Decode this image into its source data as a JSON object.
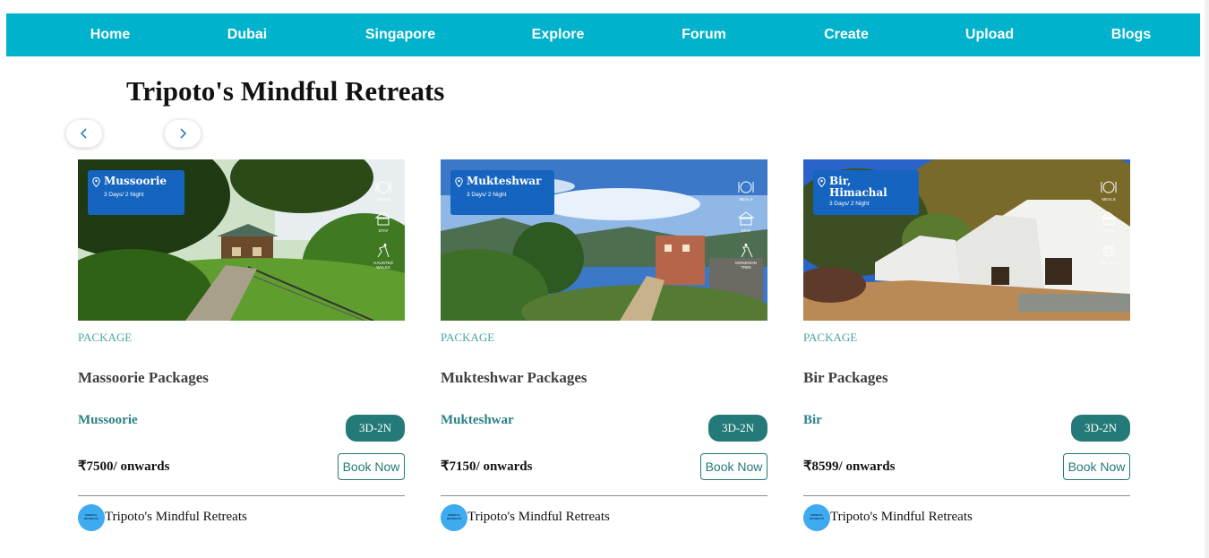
{
  "nav": {
    "items": [
      {
        "label": "Home"
      },
      {
        "label": "Dubai"
      },
      {
        "label": "Singapore"
      },
      {
        "label": "Explore"
      },
      {
        "label": "Forum"
      },
      {
        "label": "Create"
      },
      {
        "label": "Upload"
      },
      {
        "label": "Blogs"
      }
    ],
    "background": "#00b2cb"
  },
  "page": {
    "title": "Tripoto's Mindful Retreats"
  },
  "carousel": {
    "prev_icon": "chevron-left-icon",
    "next_icon": "chevron-right-icon"
  },
  "cards": [
    {
      "image_badge": {
        "name": "Mussoorie",
        "days": "3 Days/ 2 Night"
      },
      "amenities": [
        {
          "label": "MEALS",
          "icon": "meals-icon"
        },
        {
          "label": "STAY",
          "icon": "stay-icon"
        },
        {
          "label": "HAUNTED WALKS",
          "icon": "haunted-walk-icon"
        }
      ],
      "tag": "PACKAGE",
      "title": "Massoorie Packages",
      "destination": "Mussoorie",
      "duration": "3D-2N",
      "price": "₹7500/ onwards",
      "cta": "Book Now",
      "author": "Tripoto's Mindful Retreats"
    },
    {
      "image_badge": {
        "name": "Mukteshwar",
        "days": "3 Days/ 2 Night"
      },
      "amenities": [
        {
          "label": "MEALS",
          "icon": "meals-icon"
        },
        {
          "label": "STAY",
          "icon": "stay-icon"
        },
        {
          "label": "MONSOON TREK",
          "icon": "trek-icon"
        }
      ],
      "tag": "PACKAGE",
      "title": "Mukteshwar Packages",
      "destination": "Mukteshwar",
      "duration": "3D-2N",
      "price": "₹7150/ onwards",
      "cta": "Book Now",
      "author": "Tripoto's Mindful Retreats"
    },
    {
      "image_badge": {
        "name": "Bir, Himachal",
        "days": "3 Days/ 2 Night"
      },
      "amenities": [
        {
          "label": "MEALS",
          "icon": "meals-icon"
        },
        {
          "label": "STAY",
          "icon": "stay-icon"
        },
        {
          "label": "TOY TRAIN",
          "icon": "toy-train-icon"
        }
      ],
      "tag": "PACKAGE",
      "title": "Bir Packages",
      "destination": "Bir",
      "duration": "3D-2N",
      "price": "₹8599/ onwards",
      "cta": "Book Now",
      "author": "Tripoto's Mindful Retreats"
    }
  ],
  "author_logo_text": "MINDFUL RETREATS",
  "colors": {
    "accent_teal": "#237a78",
    "badge_blue": "#1565c0",
    "tag_teal": "#4aa3a7",
    "avatar_blue": "#3eaaf0"
  }
}
